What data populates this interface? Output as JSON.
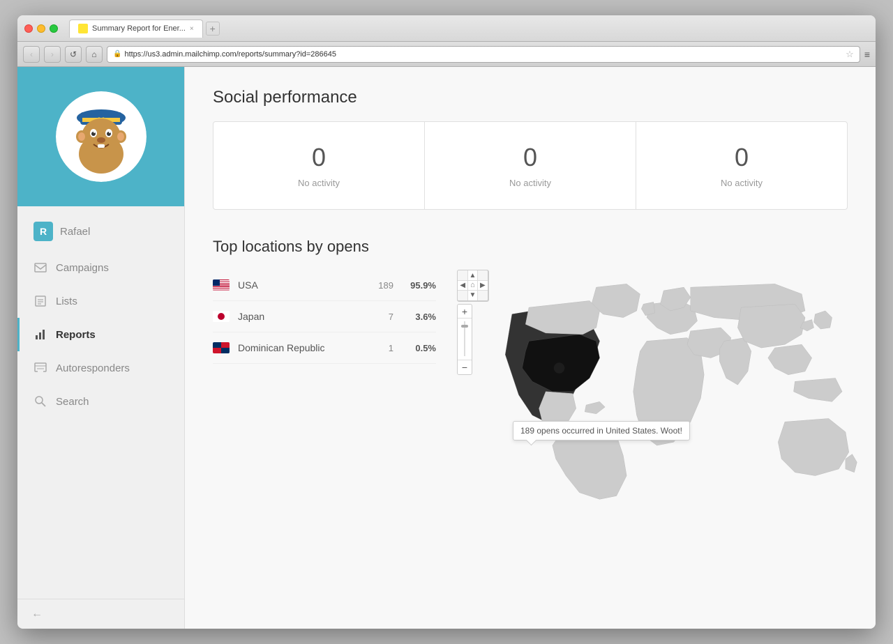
{
  "browser": {
    "tab_title": "Summary Report for Ener...",
    "tab_close": "×",
    "address": "https://us3.admin.mailchimp.com/reports/summary?id=286645",
    "nav": {
      "back": "‹",
      "forward": "›",
      "refresh": "↺",
      "home": "⌂"
    }
  },
  "sidebar": {
    "user": {
      "avatar_letter": "R",
      "name": "Rafael"
    },
    "items": [
      {
        "id": "campaigns",
        "label": "Campaigns"
      },
      {
        "id": "lists",
        "label": "Lists"
      },
      {
        "id": "reports",
        "label": "Reports",
        "active": true
      },
      {
        "id": "autoresponders",
        "label": "Autoresponders"
      },
      {
        "id": "search",
        "label": "Search"
      }
    ],
    "collapse_label": "←"
  },
  "main": {
    "social_performance": {
      "title": "Social performance",
      "cards": [
        {
          "number": "0",
          "label": "No activity"
        },
        {
          "number": "0",
          "label": "No activity"
        },
        {
          "number": "0",
          "label": "No activity"
        }
      ]
    },
    "top_locations": {
      "title": "Top locations by opens",
      "locations": [
        {
          "country": "USA",
          "flag": "usa",
          "count": "189",
          "pct": "95.9%"
        },
        {
          "country": "Japan",
          "flag": "japan",
          "count": "7",
          "pct": "3.6%"
        },
        {
          "country": "Dominican Republic",
          "flag": "dr",
          "count": "1",
          "pct": "0.5%"
        }
      ],
      "map_tooltip": "189 opens occurred in United States. Woot!"
    }
  }
}
